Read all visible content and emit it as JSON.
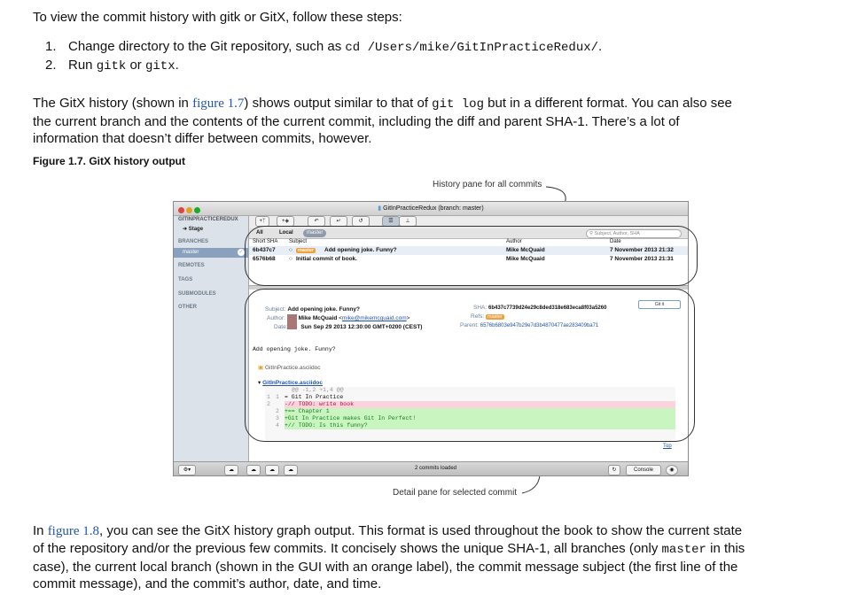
{
  "intro": "To view the commit history with gitk or GitX, follow these steps:",
  "steps": [
    {
      "num": "1.",
      "pre": "Change directory to the Git repository, such as ",
      "code": "cd /Users/mike/GitInPracticeRedux/",
      "post": "."
    },
    {
      "num": "2.",
      "pre": "Run ",
      "code": "gitk",
      "mid": " or ",
      "code2": "gitx",
      "post": "."
    }
  ],
  "para1": {
    "a": "The GitX history (shown in ",
    "link": "figure 1.7",
    "b": ") shows output similar to that of ",
    "code": "git log",
    "c": " but in a different format. You can also see",
    "line2": "the current branch and the contents of the current commit, including the diff and parent SHA-1. There’s a lot of",
    "line3": "information that doesn’t differ between commits, however."
  },
  "caption": "Figure 1.7. GitX history output",
  "figure": {
    "callout_top": "History pane for all commits",
    "callout_bottom": "Detail pane for selected commit",
    "window_title": "GitInPracticeRedux (branch: master)",
    "sidebar": {
      "repo": "GITINPRACTICEREDUX",
      "stage": "Stage",
      "branches": "BRANCHES",
      "branch_selected": "master",
      "remotes": "REMOTES",
      "tags": "TAGS",
      "submodules": "SUBMODULES",
      "other": "OTHER"
    },
    "filter": {
      "all": "All",
      "local": "Local",
      "branch": "master",
      "search_placeholder": "Subject, Author, SHA"
    },
    "columns": [
      "Short SHA",
      "Subject",
      "Author",
      "Date"
    ],
    "commits": [
      {
        "sha": "6b437c7",
        "badge": "master",
        "subject": "Add opening joke. Funny?",
        "author": "Mike McQuaid",
        "date": "7 November 2013 21:32"
      },
      {
        "sha": "6576b68",
        "badge": "",
        "subject": "Initial commit of book.",
        "author": "Mike McQuaid",
        "date": "7 November 2013 21:31"
      }
    ],
    "detail": {
      "subject_label": "Subject:",
      "subject": "Add opening joke. Funny?",
      "author_label": "Author:",
      "author": "Mike McQuaid",
      "email": "mike@mikemcquaid.com",
      "date_label": "Date:",
      "date": "Sun Sep 29 2013 12:30:00 GMT+0200 (CEST)",
      "sha_label": "SHA:",
      "sha": "6b437c7739d24e29c8ded318e683eca8f03a5260",
      "refs_label": "Refs:",
      "refs": "master",
      "parent_label": "Parent:",
      "parent": "6576b6803e947b29e7d3b4870477ae283409ba71",
      "gitit": "Git it",
      "message": "Add opening joke. Funny?",
      "file": "GitInPractice.asciidoc",
      "diff_file": "GitInPractice.asciidoc",
      "hunk": "@@ -1,2 +1,4 @@",
      "diff_lines": [
        {
          "o": "1",
          "n": "1",
          "text": "  = Git In Practice",
          "kind": "ctx"
        },
        {
          "o": "2",
          "n": "",
          "text": " -// TODO: write book",
          "kind": "del"
        },
        {
          "o": "",
          "n": "2",
          "text": " +== Chapter 1",
          "kind": "add"
        },
        {
          "o": "",
          "n": "3",
          "text": " +Git In Practice makes Git In Perfect!",
          "kind": "add"
        },
        {
          "o": "",
          "n": "4",
          "text": " +// TODO: Is this funny?",
          "kind": "add"
        }
      ],
      "top_link": "Top"
    },
    "status": {
      "commits_loaded": "2 commits loaded",
      "console": "Console"
    }
  },
  "para2": {
    "a": "In ",
    "link": "figure 1.8",
    "b": ", you can see the GitX history graph output. This format is used throughout the book to show the current state",
    "line2": "of the repository and/or the previous few commits. It concisely shows the unique SHA-1, all branches (only ",
    "code": "master",
    "c": " in this",
    "line3": "case), the current local branch (shown in the GUI with an orange label), the commit message subject (the first line of the",
    "line4": "commit message), and the commit’s author, date, and time."
  }
}
